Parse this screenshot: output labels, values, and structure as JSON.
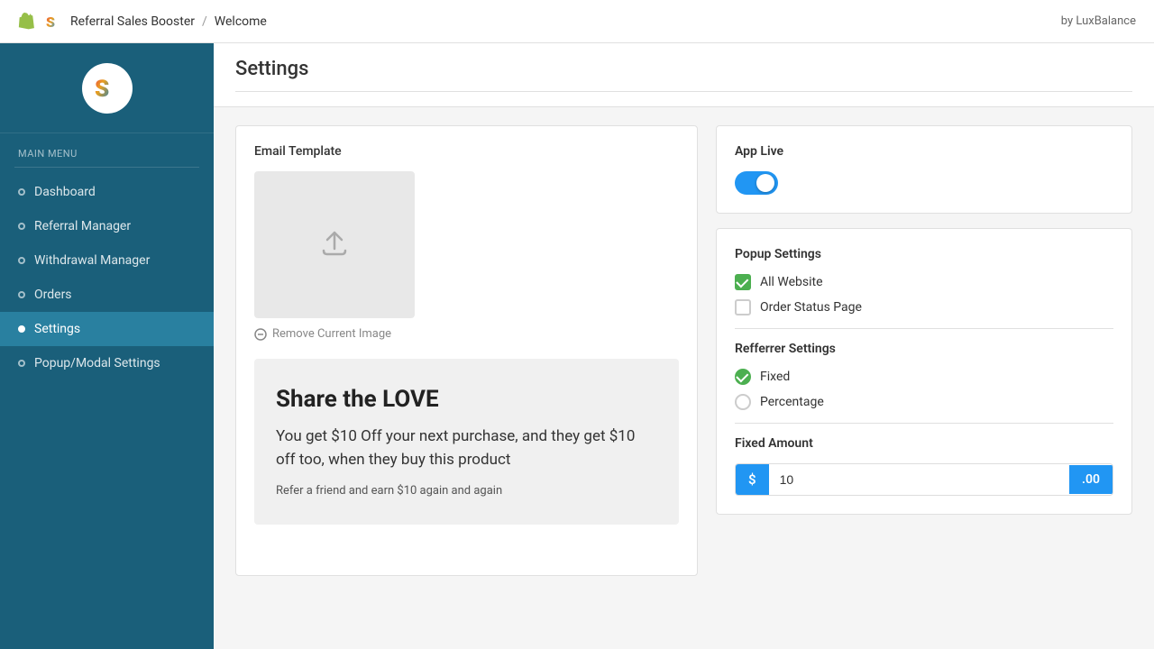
{
  "topbar": {
    "app_name": "Referral Sales Booster",
    "separator": "/",
    "page_name": "Welcome",
    "by_label": "by LuxBalance"
  },
  "sidebar": {
    "section_label": "Main Menu",
    "items": [
      {
        "id": "dashboard",
        "label": "Dashboard",
        "active": false
      },
      {
        "id": "referral-manager",
        "label": "Referral Manager",
        "active": false
      },
      {
        "id": "withdrawal-manager",
        "label": "Withdrawal Manager",
        "active": false
      },
      {
        "id": "orders",
        "label": "Orders",
        "active": false
      },
      {
        "id": "settings",
        "label": "Settings",
        "active": true
      },
      {
        "id": "popup-modal-settings",
        "label": "Popup/Modal Settings",
        "active": false
      }
    ]
  },
  "content": {
    "page_title": "Settings",
    "left_panel": {
      "section_title": "Email Template",
      "remove_image_label": "Remove Current Image",
      "preview": {
        "heading": "Share the LOVE",
        "body": "You get $10 Off your next purchase, and they get $10 off too, when they buy this product",
        "sub": "Refer a friend and earn $10 again and again"
      }
    },
    "right_panel": {
      "app_live_section": {
        "title": "App Live",
        "toggle_on": true
      },
      "popup_settings_section": {
        "title": "Popup Settings",
        "options": [
          {
            "id": "all-website",
            "label": "All Website",
            "checked": true
          },
          {
            "id": "order-status-page",
            "label": "Order Status Page",
            "checked": false
          }
        ]
      },
      "referrer_settings_section": {
        "title": "Refferrer Settings",
        "options": [
          {
            "id": "fixed",
            "label": "Fixed",
            "selected": true
          },
          {
            "id": "percentage",
            "label": "Percentage",
            "selected": false
          }
        ]
      },
      "fixed_amount_section": {
        "title": "Fixed Amount",
        "prefix": "$",
        "value": "10",
        "suffix": ".00"
      }
    }
  }
}
